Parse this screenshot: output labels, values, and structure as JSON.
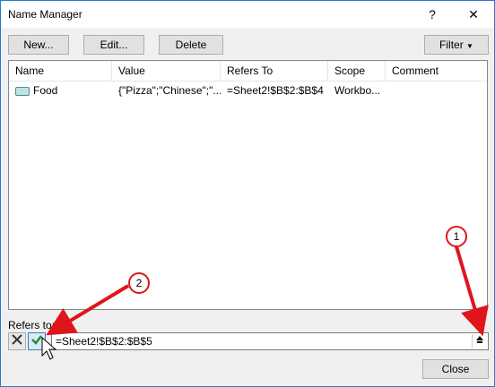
{
  "window": {
    "title": "Name Manager",
    "help": "?",
    "close": "✕"
  },
  "toolbar": {
    "new": "New...",
    "edit": "Edit...",
    "delete": "Delete",
    "filter": "Filter"
  },
  "columns": [
    "Name",
    "Value",
    "Refers To",
    "Scope",
    "Comment"
  ],
  "rows": [
    {
      "name": "Food",
      "value": "{\"Pizza\";\"Chinese\";\"...",
      "refers_to": "=Sheet2!$B$2:$B$4",
      "scope": "Workbo...",
      "comment": ""
    }
  ],
  "refers": {
    "label": "Refers to:",
    "value": "=Sheet2!$B$2:$B$5"
  },
  "buttons": {
    "close": "Close"
  },
  "callouts": [
    "1",
    "2"
  ],
  "colors": {
    "accent": "#2b79c9",
    "arrow": "#e0151c",
    "check": "#1a8f3c"
  }
}
